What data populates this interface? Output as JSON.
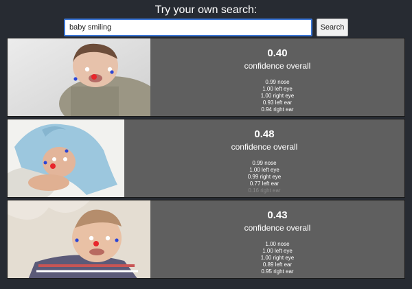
{
  "header": {
    "title": "Try your own search:"
  },
  "search": {
    "value": "baby smiling",
    "button_label": "Search"
  },
  "results": [
    {
      "score": "0.40",
      "score_label": "confidence overall",
      "parts": [
        {
          "text": "0.99 nose"
        },
        {
          "text": "1.00 left eye"
        },
        {
          "text": "1.00 right eye"
        },
        {
          "text": "0.93 left ear"
        },
        {
          "text": "0.94 right ear"
        }
      ]
    },
    {
      "score": "0.48",
      "score_label": "confidence overall",
      "parts": [
        {
          "text": "0.99 nose"
        },
        {
          "text": "1.00 left eye"
        },
        {
          "text": "0.99 right eye"
        },
        {
          "text": "0.77 left ear"
        },
        {
          "text": "0.16 right ear"
        }
      ]
    },
    {
      "score": "0.43",
      "score_label": "confidence overall",
      "parts": [
        {
          "text": "1.00 nose"
        },
        {
          "text": "1.00 left eye"
        },
        {
          "text": "1.00 right eye"
        },
        {
          "text": "0.89 left ear"
        },
        {
          "text": "0.95 right ear"
        }
      ]
    }
  ],
  "colors": {
    "page_background": "#272b32",
    "panel_background": "#5f5f5f",
    "input_border": "#3b76d6",
    "nose_marker": "#e8262b",
    "ear_marker": "#2b45d6",
    "eye_marker": "#ffffff"
  }
}
